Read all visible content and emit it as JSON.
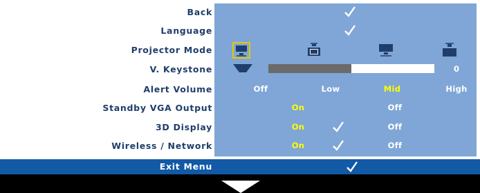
{
  "menu": {
    "back_label": "Back",
    "language_label": "Language",
    "projector_mode": {
      "label": "Projector Mode",
      "options": [
        {
          "name": "front-projection-desktop-icon",
          "selected": true
        },
        {
          "name": "rear-projection-ceiling-icon",
          "selected": false
        },
        {
          "name": "rear-projection-desktop-icon",
          "selected": false
        },
        {
          "name": "front-projection-ceiling-icon",
          "selected": false
        }
      ]
    },
    "v_keystone": {
      "label": "V. Keystone",
      "value": "0",
      "level": 0.5
    },
    "alert_volume": {
      "label": "Alert Volume",
      "options": [
        "Off",
        "Low",
        "Mid",
        "High"
      ],
      "selected": "Mid"
    },
    "standby_vga_output": {
      "label": "Standby VGA Output",
      "on": "On",
      "off": "Off",
      "selected": "On"
    },
    "display_3d": {
      "label": "3D Display",
      "on": "On",
      "off": "Off",
      "selected": "On"
    },
    "wireless_network": {
      "label": "Wireless / Network",
      "on": "On",
      "off": "Off",
      "selected": "On"
    },
    "exit_label": "Exit Menu"
  },
  "colors": {
    "label_text": "#1f3e6b",
    "panel_blue": "#7fa6d6",
    "selected_text": "#ffff00",
    "exit_bar": "#1259a6",
    "selected_icon_border": "#e8c800"
  }
}
